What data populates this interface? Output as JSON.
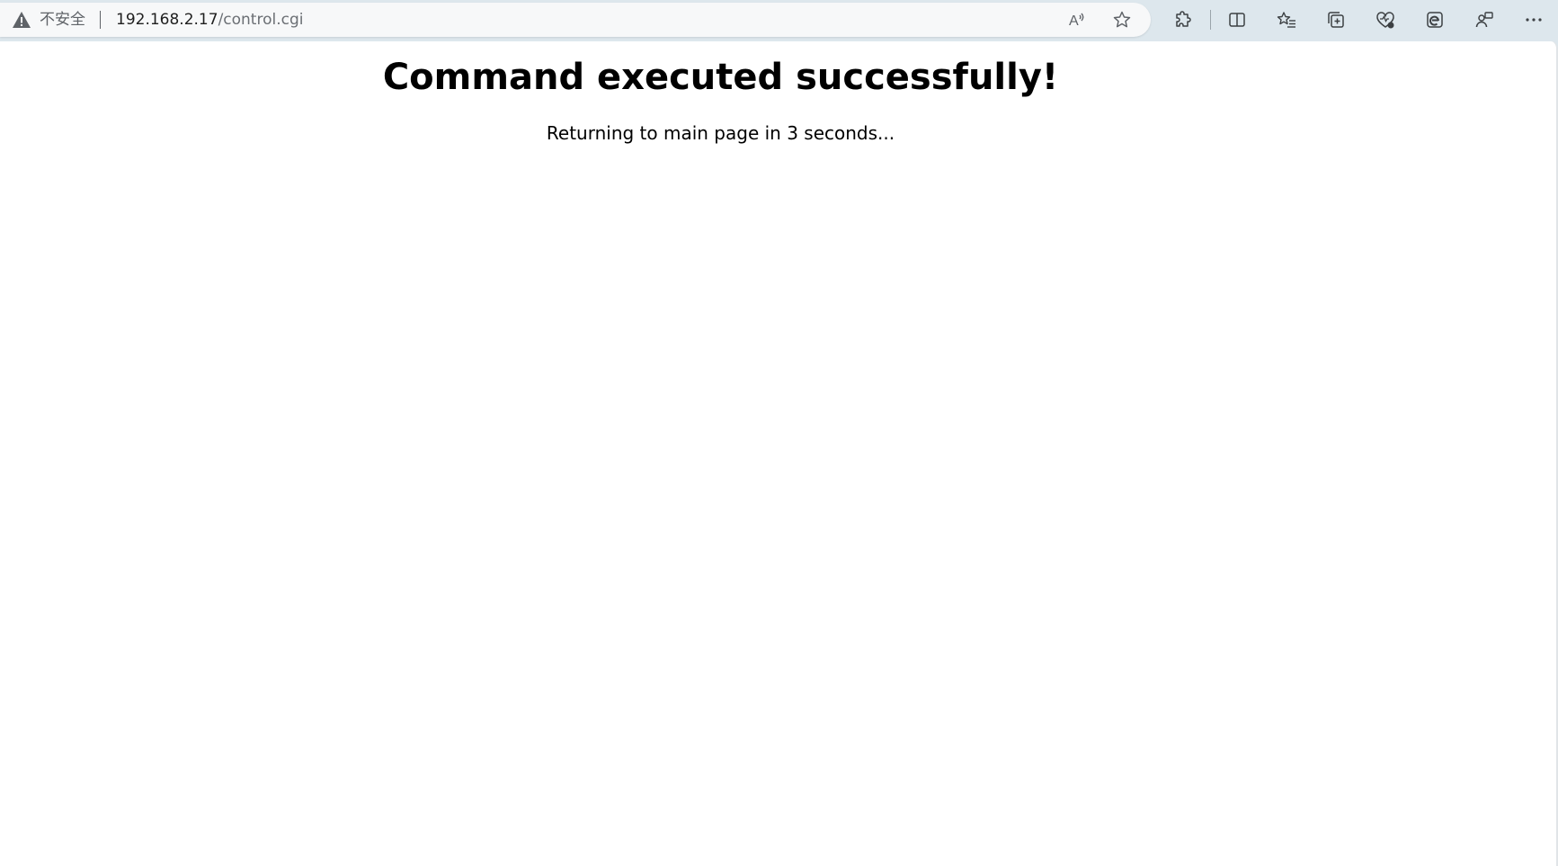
{
  "browser": {
    "security_label": "不安全",
    "url_host": "192.168.2.17",
    "url_path": "/control.cgi",
    "toolbar_icons": [
      "read-aloud-icon",
      "favorite-star-icon",
      "extensions-icon",
      "split-screen-icon",
      "favorites-icon",
      "collections-icon",
      "browser-essentials-icon",
      "edge-copilot-icon",
      "profile-sync-icon",
      "more-menu-icon"
    ]
  },
  "page": {
    "heading": "Command executed successfully!",
    "message": "Returning to main page in 3 seconds..."
  },
  "colors": {
    "toolbar_bg": "#dde7ed",
    "addressbar_bg": "#f7f8f9",
    "page_bg": "#ffffff",
    "text": "#000000"
  }
}
